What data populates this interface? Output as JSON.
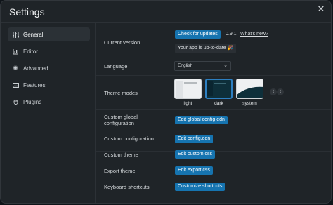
{
  "window": {
    "title": "Settings",
    "close_icon": "close-icon"
  },
  "sidebar": {
    "items": [
      {
        "label": "General",
        "icon": "sliders-icon",
        "active": true
      },
      {
        "label": "Editor",
        "icon": "bar-chart-icon",
        "active": false
      },
      {
        "label": "Advanced",
        "icon": "sun-icon",
        "active": false
      },
      {
        "label": "Features",
        "icon": "image-icon",
        "active": false
      },
      {
        "label": "Plugins",
        "icon": "plug-icon",
        "active": false
      }
    ]
  },
  "settings": {
    "current_version": {
      "label": "Current version",
      "check_button": "Check for updates",
      "version": "0.9.1",
      "whats_new": "What's new?",
      "status": "Your app is up-to-date 🎉"
    },
    "language": {
      "label": "Language",
      "selected": "English"
    },
    "theme_modes": {
      "label": "Theme modes",
      "options": [
        "light",
        "dark",
        "system"
      ],
      "selected": "dark",
      "shortcut_keys": [
        "t",
        "t"
      ]
    },
    "custom_global_configuration": {
      "label_line1": "Custom global",
      "label_line2": "configuration",
      "button": "Edit global config.edn"
    },
    "custom_configuration": {
      "label": "Custom configuration",
      "button": "Edit config.edn"
    },
    "custom_theme": {
      "label": "Custom theme",
      "button": "Edit custom.css"
    },
    "export_theme": {
      "label": "Export theme",
      "button": "Edit export.css"
    },
    "keyboard_shortcuts": {
      "label": "Keyboard shortcuts",
      "button": "Customize shortcuts"
    }
  },
  "colors": {
    "accent": "#1674b0",
    "selected_outline": "#2d7fc1",
    "background": "#1f2428"
  }
}
